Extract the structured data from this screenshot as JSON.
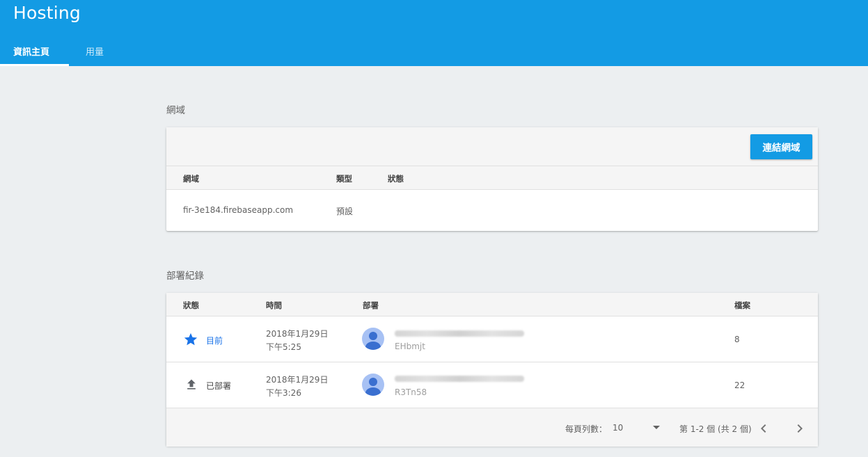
{
  "app": {
    "title": "Hosting"
  },
  "tabs": [
    {
      "label": "資訊主頁",
      "active": true
    },
    {
      "label": "用量",
      "active": false
    }
  ],
  "domains": {
    "section_title": "網域",
    "connect_button": "連結網域",
    "columns": [
      "網域",
      "類型",
      "狀態"
    ],
    "rows": [
      {
        "domain": "fir-3e184.firebaseapp.com",
        "type": "預設",
        "status": ""
      }
    ]
  },
  "deploys": {
    "section_title": "部署紀錄",
    "columns": [
      "狀態",
      "時間",
      "部署",
      "檔案"
    ],
    "rows": [
      {
        "status": "目前",
        "status_icon": "star-icon",
        "date": "2018年1月29日",
        "time": "下午5:25",
        "deployer": "",
        "deploy_id": "EHbmjt",
        "files": "8"
      },
      {
        "status": "已部署",
        "status_icon": "upload-icon",
        "date": "2018年1月29日",
        "time": "下午3:26",
        "deployer": "",
        "deploy_id": "R3Tn58",
        "files": "22"
      }
    ],
    "pagination": {
      "rows_per_page_label": "每頁列數：",
      "rows_per_page_value": "10",
      "range_text": "第 1-2 個 (共 2 個)"
    }
  },
  "colors": {
    "accent": "#139be4",
    "background": "#eceff1",
    "current_status": "#1a73e8"
  }
}
